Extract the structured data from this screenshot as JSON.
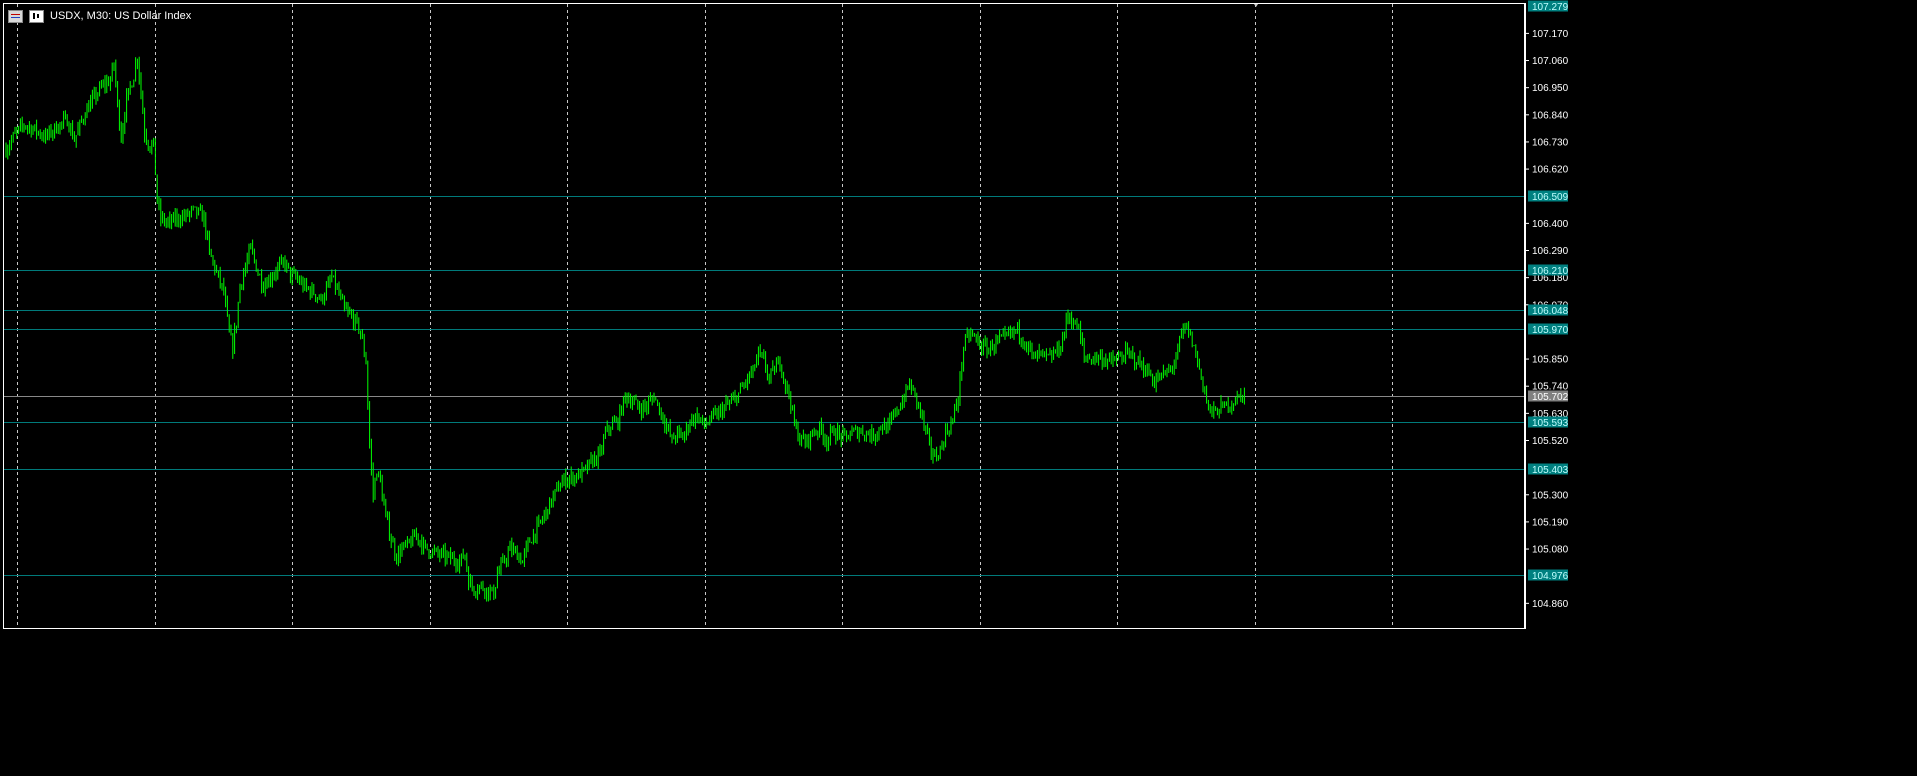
{
  "window": {
    "title": "USDX, M30:  US Dollar Index",
    "icons": [
      "market-watch-icon",
      "chart-type-icon"
    ]
  },
  "colors": {
    "background": "#000000",
    "foreground": "#ffffff",
    "grid": "#c8c8c8",
    "candle": "#00ff00",
    "level_line": "#007a7a",
    "level_label_bg": "#008080",
    "price_line": "#888888",
    "price_label_bg": "#808080"
  },
  "chart_data": {
    "type": "candlestick",
    "symbol": "USDX",
    "timeframe": "M30",
    "description": "US Dollar Index",
    "ylim": [
      104.76,
      107.281
    ],
    "y_ticks": [
      "107.170",
      "107.060",
      "106.950",
      "106.840",
      "106.730",
      "106.620",
      "106.400",
      "106.290",
      "106.180",
      "106.070",
      "105.850",
      "105.740",
      "105.630",
      "105.520",
      "105.300",
      "105.190",
      "105.080",
      "104.860"
    ],
    "top_label": "107.279",
    "horizontal_levels": [
      "106.509",
      "106.210",
      "106.048",
      "105.970",
      "105.593",
      "105.403",
      "104.976"
    ],
    "current_price": "105.702",
    "grid": "vertical-dashed",
    "close_path": [
      [
        0,
        106.7
      ],
      [
        5,
        106.76
      ],
      [
        10,
        106.8
      ],
      [
        16,
        106.78
      ],
      [
        22,
        106.75
      ],
      [
        28,
        106.79
      ],
      [
        34,
        106.82
      ],
      [
        38,
        106.74
      ],
      [
        44,
        106.85
      ],
      [
        50,
        106.92
      ],
      [
        54,
        106.96
      ],
      [
        58,
        106.98
      ],
      [
        60,
        107.05
      ],
      [
        62,
        106.88
      ],
      [
        64,
        106.75
      ],
      [
        67,
        106.9
      ],
      [
        71,
        107.0
      ],
      [
        73,
        107.08
      ],
      [
        75,
        106.93
      ],
      [
        77,
        106.77
      ],
      [
        80,
        106.71
      ],
      [
        82,
        106.72
      ],
      [
        84,
        106.49
      ],
      [
        86,
        106.42
      ],
      [
        90,
        106.4
      ],
      [
        95,
        106.42
      ],
      [
        100,
        106.43
      ],
      [
        104,
        106.45
      ],
      [
        107,
        106.44
      ],
      [
        110,
        106.42
      ],
      [
        113,
        106.28
      ],
      [
        118,
        106.18
      ],
      [
        121,
        106.12
      ],
      [
        124,
        105.95
      ],
      [
        126,
        105.9
      ],
      [
        128,
        106.0
      ],
      [
        130,
        106.15
      ],
      [
        133,
        106.22
      ],
      [
        136,
        106.3
      ],
      [
        140,
        106.2
      ],
      [
        143,
        106.15
      ],
      [
        147,
        106.18
      ],
      [
        151,
        106.22
      ],
      [
        155,
        106.24
      ],
      [
        158,
        106.19
      ],
      [
        161,
        106.18
      ],
      [
        166,
        106.14
      ],
      [
        171,
        106.12
      ],
      [
        175,
        106.09
      ],
      [
        178,
        106.13
      ],
      [
        181,
        106.18
      ],
      [
        184,
        106.13
      ],
      [
        188,
        106.05
      ],
      [
        192,
        106.02
      ],
      [
        196,
        105.98
      ],
      [
        198,
        105.92
      ],
      [
        200,
        105.84
      ],
      [
        202,
        105.5
      ],
      [
        204,
        105.3
      ],
      [
        206,
        105.4
      ],
      [
        208,
        105.35
      ],
      [
        210,
        105.25
      ],
      [
        212,
        105.18
      ],
      [
        214,
        105.12
      ],
      [
        217,
        105.05
      ],
      [
        220,
        105.08
      ],
      [
        224,
        105.1
      ],
      [
        228,
        105.14
      ],
      [
        232,
        105.09
      ],
      [
        236,
        105.07
      ],
      [
        240,
        105.06
      ],
      [
        244,
        105.05
      ],
      [
        248,
        105.04
      ],
      [
        252,
        105.03
      ],
      [
        255,
        105.06
      ],
      [
        257,
        104.95
      ],
      [
        260,
        104.92
      ],
      [
        264,
        104.93
      ],
      [
        268,
        104.91
      ],
      [
        271,
        104.9
      ],
      [
        273,
        104.98
      ],
      [
        276,
        105.02
      ],
      [
        280,
        105.08
      ],
      [
        284,
        105.06
      ],
      [
        287,
        105.03
      ],
      [
        290,
        105.1
      ],
      [
        294,
        105.15
      ],
      [
        298,
        105.2
      ],
      [
        302,
        105.26
      ],
      [
        306,
        105.32
      ],
      [
        310,
        105.36
      ],
      [
        314,
        105.37
      ],
      [
        318,
        105.38
      ],
      [
        322,
        105.4
      ],
      [
        326,
        105.44
      ],
      [
        330,
        105.46
      ],
      [
        333,
        105.55
      ],
      [
        336,
        105.58
      ],
      [
        340,
        105.6
      ],
      [
        344,
        105.7
      ],
      [
        348,
        105.68
      ],
      [
        352,
        105.65
      ],
      [
        356,
        105.66
      ],
      [
        360,
        105.7
      ],
      [
        364,
        105.63
      ],
      [
        367,
        105.58
      ],
      [
        370,
        105.52
      ],
      [
        373,
        105.55
      ],
      [
        376,
        105.53
      ],
      [
        380,
        105.6
      ],
      [
        384,
        105.62
      ],
      [
        388,
        105.58
      ],
      [
        392,
        105.61
      ],
      [
        396,
        105.63
      ],
      [
        400,
        105.66
      ],
      [
        404,
        105.68
      ],
      [
        408,
        105.72
      ],
      [
        412,
        105.77
      ],
      [
        415,
        105.8
      ],
      [
        418,
        105.87
      ],
      [
        421,
        105.84
      ],
      [
        424,
        105.77
      ],
      [
        427,
        105.81
      ],
      [
        430,
        105.84
      ],
      [
        433,
        105.75
      ],
      [
        436,
        105.68
      ],
      [
        438,
        105.58
      ],
      [
        441,
        105.53
      ],
      [
        444,
        105.51
      ],
      [
        448,
        105.55
      ],
      [
        452,
        105.57
      ],
      [
        456,
        105.52
      ],
      [
        460,
        105.56
      ],
      [
        463,
        105.54
      ],
      [
        466,
        105.53
      ],
      [
        470,
        105.55
      ],
      [
        474,
        105.56
      ],
      [
        478,
        105.55
      ],
      [
        482,
        105.54
      ],
      [
        486,
        105.58
      ],
      [
        490,
        105.57
      ],
      [
        494,
        105.63
      ],
      [
        498,
        105.68
      ],
      [
        502,
        105.75
      ],
      [
        505,
        105.7
      ],
      [
        508,
        105.64
      ],
      [
        511,
        105.55
      ],
      [
        514,
        105.48
      ],
      [
        516,
        105.45
      ],
      [
        519,
        105.48
      ],
      [
        522,
        105.55
      ],
      [
        526,
        105.6
      ],
      [
        529,
        105.7
      ],
      [
        532,
        105.9
      ],
      [
        535,
        105.95
      ],
      [
        538,
        105.94
      ],
      [
        542,
        105.9
      ],
      [
        546,
        105.89
      ],
      [
        550,
        105.92
      ],
      [
        554,
        105.93
      ],
      [
        558,
        105.95
      ],
      [
        562,
        105.97
      ],
      [
        565,
        105.93
      ],
      [
        568,
        105.9
      ],
      [
        571,
        105.85
      ],
      [
        574,
        105.87
      ],
      [
        577,
        105.86
      ],
      [
        580,
        105.85
      ],
      [
        583,
        105.88
      ],
      [
        586,
        105.9
      ],
      [
        590,
        106.03
      ],
      [
        593,
        106.0
      ],
      [
        596,
        105.97
      ],
      [
        599,
        105.86
      ],
      [
        602,
        105.85
      ],
      [
        606,
        105.86
      ],
      [
        610,
        105.85
      ],
      [
        614,
        105.84
      ],
      [
        618,
        105.85
      ],
      [
        622,
        105.87
      ],
      [
        626,
        105.86
      ],
      [
        630,
        105.83
      ],
      [
        634,
        105.8
      ],
      [
        638,
        105.76
      ],
      [
        642,
        105.78
      ],
      [
        646,
        105.8
      ],
      [
        650,
        105.85
      ],
      [
        653,
        105.95
      ],
      [
        656,
        105.98
      ],
      [
        659,
        105.92
      ],
      [
        662,
        105.84
      ],
      [
        665,
        105.75
      ],
      [
        668,
        105.65
      ],
      [
        671,
        105.63
      ],
      [
        674,
        105.65
      ],
      [
        678,
        105.66
      ],
      [
        682,
        105.68
      ],
      [
        686,
        105.7
      ],
      [
        688,
        105.71
      ]
    ]
  }
}
